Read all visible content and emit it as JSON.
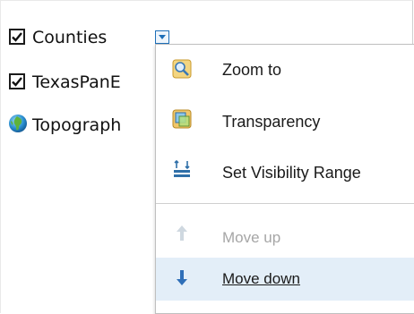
{
  "layers": [
    {
      "label": "Counties",
      "checked": true,
      "type": "checkbox"
    },
    {
      "label": "TexasPanE",
      "checked": true,
      "type": "checkbox"
    },
    {
      "label": "Topograph",
      "type": "basemap-globe-icon"
    }
  ],
  "menu": {
    "items": [
      {
        "label": "Zoom to",
        "icon": "zoom-to-icon",
        "enabled": true
      },
      {
        "label": "Transparency",
        "icon": "transparency-icon",
        "enabled": true
      },
      {
        "label": "Set Visibility Range",
        "icon": "visibility-range-icon",
        "enabled": true
      },
      {
        "label": "Move up",
        "icon": "arrow-up-icon",
        "enabled": false
      },
      {
        "label": "Move down",
        "icon": "arrow-down-icon",
        "enabled": true,
        "hovered": true
      }
    ]
  },
  "colors": {
    "accent_blue": "#1e6fb8",
    "hover_bg": "#e3eef8",
    "disabled_text": "#a6a6a6"
  }
}
